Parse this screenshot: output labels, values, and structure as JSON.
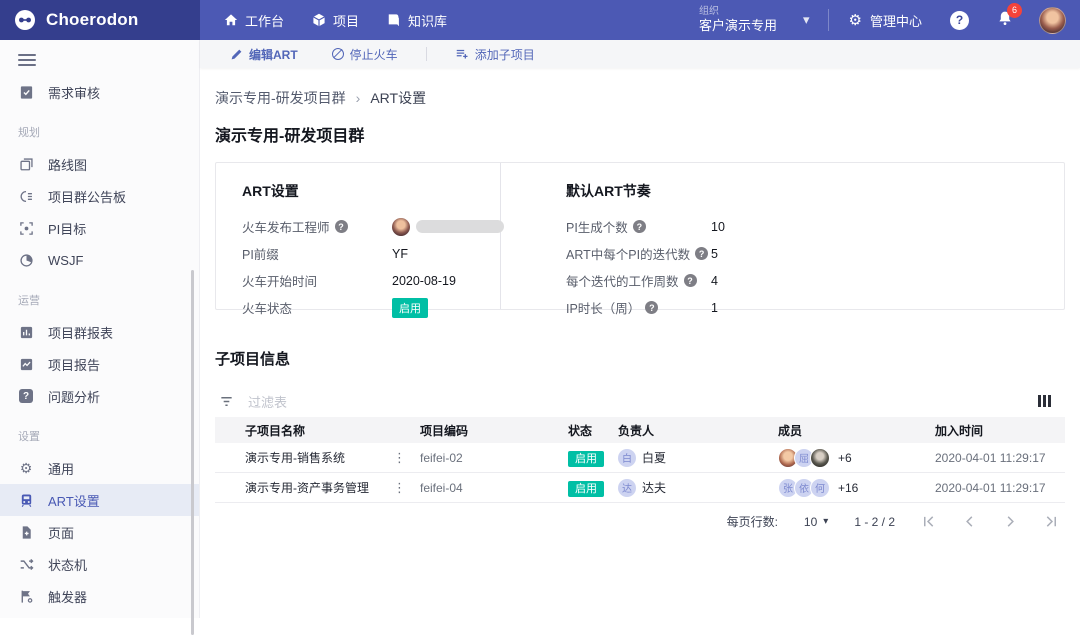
{
  "header": {
    "logo_text": "Choerodon",
    "nav": [
      {
        "label": "工作台"
      },
      {
        "label": "项目"
      },
      {
        "label": "知识库"
      }
    ],
    "org_label": "组织",
    "org_name": "客户演示专用",
    "admin_center": "管理中心",
    "help_glyph": "?",
    "notification_count": "6"
  },
  "sidebar": {
    "standalone": {
      "label": "需求审核"
    },
    "groups": [
      {
        "title": "规划",
        "items": [
          {
            "label": "路线图"
          },
          {
            "label": "项目群公告板"
          },
          {
            "label": "PI目标"
          },
          {
            "label": "WSJF"
          }
        ]
      },
      {
        "title": "运营",
        "items": [
          {
            "label": "项目群报表"
          },
          {
            "label": "项目报告"
          },
          {
            "label": "问题分析"
          }
        ]
      },
      {
        "title": "设置",
        "items": [
          {
            "label": "通用"
          },
          {
            "label": "ART设置"
          },
          {
            "label": "页面"
          },
          {
            "label": "状态机"
          },
          {
            "label": "触发器"
          }
        ]
      }
    ]
  },
  "toolbar": {
    "edit_label": "编辑ART",
    "stop_label": "停止火车",
    "add_label": "添加子项目"
  },
  "breadcrumb": {
    "parent": "演示专用-研发项目群",
    "separator": "›",
    "current": "ART设置"
  },
  "page_title": "演示专用-研发项目群",
  "art_card": {
    "title": "ART设置",
    "engineer_label": "火车发布工程师",
    "pi_prefix_label": "PI前缀",
    "pi_prefix_value": "YF",
    "start_label": "火车开始时间",
    "start_value": "2020-08-19",
    "status_label": "火车状态",
    "status_value": "启用",
    "cadence_title": "默认ART节奏",
    "cadence_rows": [
      {
        "label": "PI生成个数",
        "value": "10"
      },
      {
        "label": "ART中每个PI的迭代数",
        "value": "5"
      },
      {
        "label": "每个迭代的工作周数",
        "value": "4"
      },
      {
        "label": "IP时长（周）",
        "value": "1"
      }
    ]
  },
  "subprojects": {
    "section_title": "子项目信息",
    "filter_placeholder": "过滤表",
    "columns": [
      "子项目名称",
      "项目编码",
      "状态",
      "负责人",
      "成员",
      "加入时间"
    ],
    "rows": [
      {
        "name": "演示专用-销售系统",
        "code": "feifei-02",
        "status": "启用",
        "owner": {
          "initial": "白",
          "name": "白夏"
        },
        "members": [
          {
            "kind": "photo"
          },
          {
            "kind": "text",
            "text": "屈"
          },
          {
            "kind": "photo"
          }
        ],
        "more": "+6",
        "joined": "2020-04-01 11:29:17"
      },
      {
        "name": "演示专用-资产事务管理",
        "code": "feifei-04",
        "status": "启用",
        "owner": {
          "initial": "达",
          "name": "达夫"
        },
        "members": [
          {
            "kind": "text",
            "text": "张"
          },
          {
            "kind": "text",
            "text": "依"
          },
          {
            "kind": "text",
            "text": "何"
          }
        ],
        "more": "+16",
        "joined": "2020-04-01 11:29:17"
      }
    ],
    "pagination": {
      "rows_label": "每页行数:",
      "page_size": "10",
      "range": "1 - 2 / 2"
    }
  },
  "icons": {
    "kebab": "⋮",
    "chevron_down": "▾",
    "gear": "⚙",
    "question": "?"
  },
  "colors": {
    "header_bg": "#4c59b4",
    "logo_bg": "#343e8d",
    "accent_blue": "#5266b8",
    "selected_item_bg": "#e7ebf5",
    "badge_green": "#00bfa5",
    "badge_red": "#f4433a",
    "avatar_lavender_bg": "#cdd3f1",
    "avatar_lavender_text": "#7c88cf"
  }
}
